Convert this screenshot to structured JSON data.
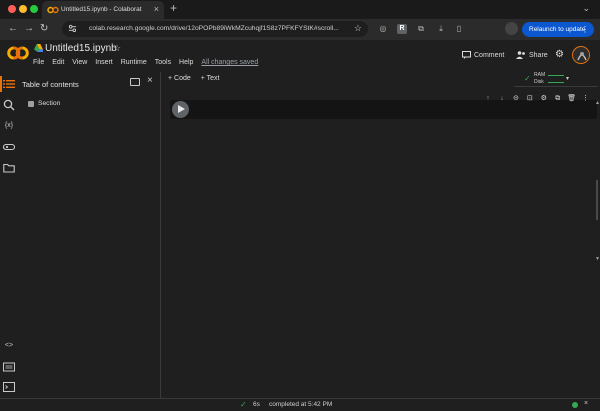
{
  "browser": {
    "tab_title": "Untitled15.ipynb - Colaborat",
    "tab_close": "×",
    "new_tab": "+",
    "url": "colab.research.google.com/drive/12oPOPb89iWkMZcuhqjf1S8z7PFKFYStK#scroll...",
    "relaunch_label": "Relaunch to update",
    "relaunch_more": "⋮",
    "icons": {
      "back": "←",
      "forward": "→",
      "reload": "↻",
      "star": "☆",
      "extension1": "◎",
      "extension2": "R",
      "puzzle": "⧉",
      "download": "⤓",
      "sidebar": "▯",
      "tab_search": "⌄"
    }
  },
  "header": {
    "notebook_title": "Untitled15.ipynb",
    "title_star": "☆",
    "menu": [
      "File",
      "Edit",
      "View",
      "Insert",
      "Runtime",
      "Tools",
      "Help"
    ],
    "saved_status": "All changes saved",
    "comment_label": "Comment",
    "share_label": "Share",
    "gear": "⚙",
    "colors": {
      "colab_orange": "#e8710a",
      "colab_yellow": "#f9ab00"
    }
  },
  "rail": {
    "icons": [
      "toc-icon",
      "search-icon",
      "variables-icon",
      "secrets-icon",
      "files-icon",
      "code-snippets-icon",
      "command-palette-icon",
      "terminal-icon"
    ],
    "variables_glyph": "{x}",
    "code_glyph": "<>"
  },
  "toc": {
    "title": "Table of contents",
    "close": "×",
    "sections": [
      "Section"
    ]
  },
  "main": {
    "add_code": "+ Code",
    "add_text": "+ Text",
    "ram_label": "RAM",
    "disk_label": "Disk",
    "check": "✓",
    "caret": "▾",
    "cell_toolbar": [
      "↑",
      "↓",
      "⊝",
      "⊡",
      "⚙",
      "⧉",
      "🗑",
      "⋮"
    ]
  },
  "status": {
    "check": "✓",
    "duration": "6s",
    "text": "completed at 5:42 PM",
    "close": "×",
    "colors": {
      "ok": "#34a853"
    }
  }
}
